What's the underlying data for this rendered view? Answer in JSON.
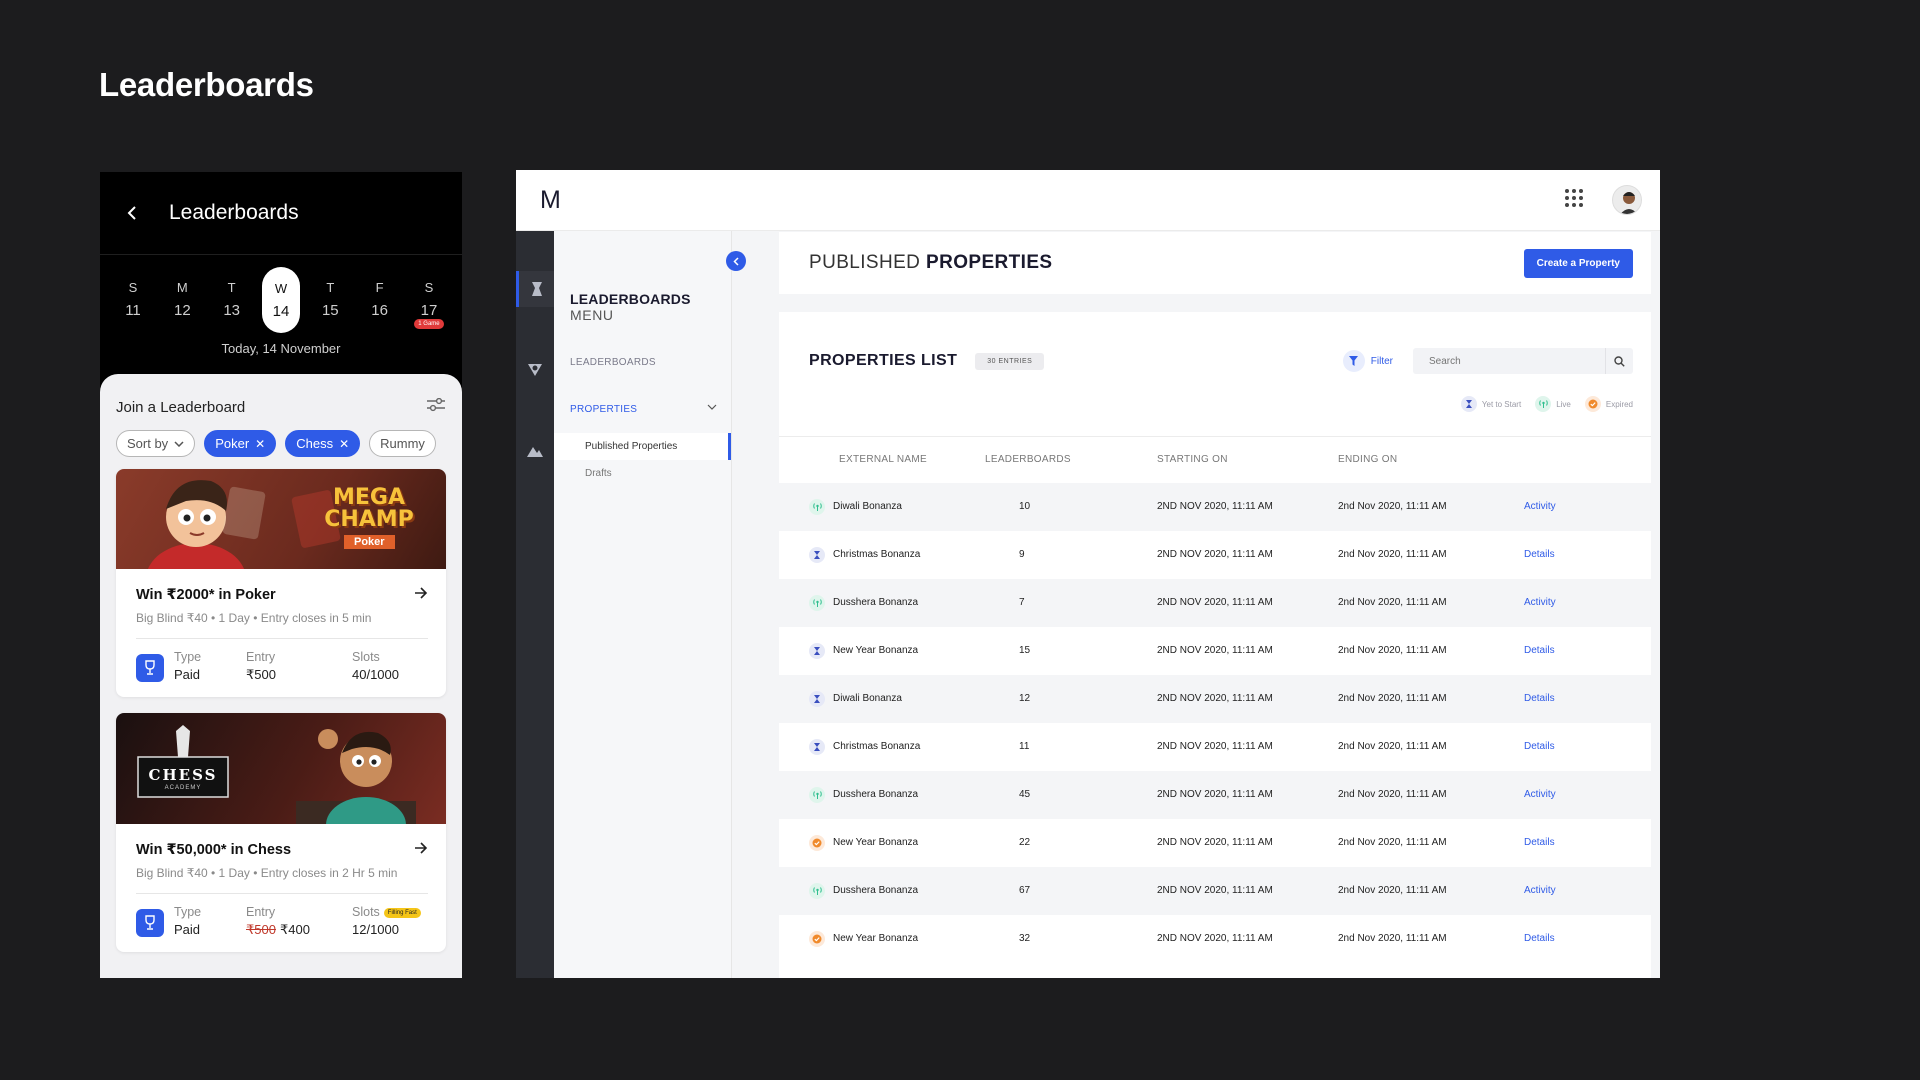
{
  "page_title": "Leaderboards",
  "mobile": {
    "header_title": "Leaderboards",
    "days": [
      {
        "letter": "S",
        "num": "11"
      },
      {
        "letter": "M",
        "num": "12"
      },
      {
        "letter": "T",
        "num": "13"
      },
      {
        "letter": "W",
        "num": "14"
      },
      {
        "letter": "T",
        "num": "15"
      },
      {
        "letter": "F",
        "num": "16"
      },
      {
        "letter": "S",
        "num": "17"
      }
    ],
    "day_badge": "1 Game",
    "today_label": "Today, 14 November",
    "join_title": "Join a Leaderboard",
    "chips": {
      "sort": "Sort by",
      "poker": "Poker",
      "chess": "Chess",
      "rummy": "Rummy"
    },
    "cards": [
      {
        "banner": "MEGA CHAMP",
        "banner_tag": "Poker",
        "title": "Win ₹2000* in Poker",
        "subtitle": "Big Blind ₹40 • 1 Day • Entry closes in 5 min",
        "type_label": "Type",
        "type_value": "Paid",
        "entry_label": "Entry",
        "entry_value": "₹500",
        "slots_label": "Slots",
        "slots_value": "40/1000"
      },
      {
        "banner": "CHESS",
        "banner_tag": "ACADEMY",
        "title": "Win ₹50,000* in Chess",
        "subtitle": "Big Blind ₹40 • 1 Day • Entry closes in 2 Hr 5 min",
        "type_label": "Type",
        "type_value": "Paid",
        "entry_label": "Entry",
        "entry_old": "₹500",
        "entry_value": "₹400",
        "slots_label": "Slots",
        "slots_badge": "Filling Fast",
        "slots_value": "12/1000"
      }
    ]
  },
  "desktop": {
    "logo": "M",
    "subnav": {
      "title": "LEADERBOARDS",
      "subtitle": "MENU",
      "item_leaderboards": "LEADERBOARDS",
      "item_properties": "PROPERTIES",
      "child_published": "Published Properties",
      "child_drafts": "Drafts"
    },
    "header": {
      "title_light": "PUBLISHED",
      "title_bold": "PROPERTIES",
      "create_button": "Create a Property"
    },
    "list": {
      "title": "PROPERTIES LIST",
      "entries": "30 ENTRIES",
      "filter": "Filter",
      "search_placeholder": "Search",
      "legend": {
        "yet": "Yet to Start",
        "live": "Live",
        "expired": "Expired"
      },
      "columns": {
        "name": "EXTERNAL NAME",
        "leaderboards": "LEADERBOARDS",
        "start": "STARTING ON",
        "end": "ENDING ON"
      },
      "rows": [
        {
          "status": "live",
          "name": "Diwali Bonanza",
          "leaderboards": "10",
          "start": "2ND NOV 2020, 11:11 AM",
          "end": "2nd Nov 2020, 11:11 AM",
          "action": "Activity"
        },
        {
          "status": "yet",
          "name": "Christmas Bonanza",
          "leaderboards": "9",
          "start": "2ND NOV 2020, 11:11 AM",
          "end": "2nd Nov 2020, 11:11 AM",
          "action": "Details"
        },
        {
          "status": "live",
          "name": "Dusshera Bonanza",
          "leaderboards": "7",
          "start": "2ND NOV 2020, 11:11 AM",
          "end": "2nd Nov 2020, 11:11 AM",
          "action": "Activity"
        },
        {
          "status": "yet",
          "name": "New Year Bonanza",
          "leaderboards": "15",
          "start": "2ND NOV 2020, 11:11 AM",
          "end": "2nd Nov 2020, 11:11 AM",
          "action": "Details"
        },
        {
          "status": "yet",
          "name": "Diwali Bonanza",
          "leaderboards": "12",
          "start": "2ND NOV 2020, 11:11 AM",
          "end": "2nd Nov 2020, 11:11 AM",
          "action": "Details"
        },
        {
          "status": "yet",
          "name": "Christmas Bonanza",
          "leaderboards": "11",
          "start": "2ND NOV 2020, 11:11 AM",
          "end": "2nd Nov 2020, 11:11 AM",
          "action": "Details"
        },
        {
          "status": "live",
          "name": "Dusshera Bonanza",
          "leaderboards": "45",
          "start": "2ND NOV 2020, 11:11 AM",
          "end": "2nd Nov 2020, 11:11 AM",
          "action": "Activity"
        },
        {
          "status": "exp",
          "name": "New Year Bonanza",
          "leaderboards": "22",
          "start": "2ND NOV 2020, 11:11 AM",
          "end": "2nd Nov 2020, 11:11 AM",
          "action": "Details"
        },
        {
          "status": "live",
          "name": "Dusshera Bonanza",
          "leaderboards": "67",
          "start": "2ND NOV 2020, 11:11 AM",
          "end": "2nd Nov 2020, 11:11 AM",
          "action": "Activity"
        },
        {
          "status": "exp",
          "name": "New Year Bonanza",
          "leaderboards": "32",
          "start": "2ND NOV 2020, 11:11 AM",
          "end": "2nd Nov 2020, 11:11 AM",
          "action": "Details"
        }
      ]
    }
  },
  "colors": {
    "accent": "#2f5be7",
    "live": "#2fbf8f",
    "yet": "#3a4fbf",
    "expired": "#f08a2c",
    "badge_red": "#e03a3a"
  }
}
